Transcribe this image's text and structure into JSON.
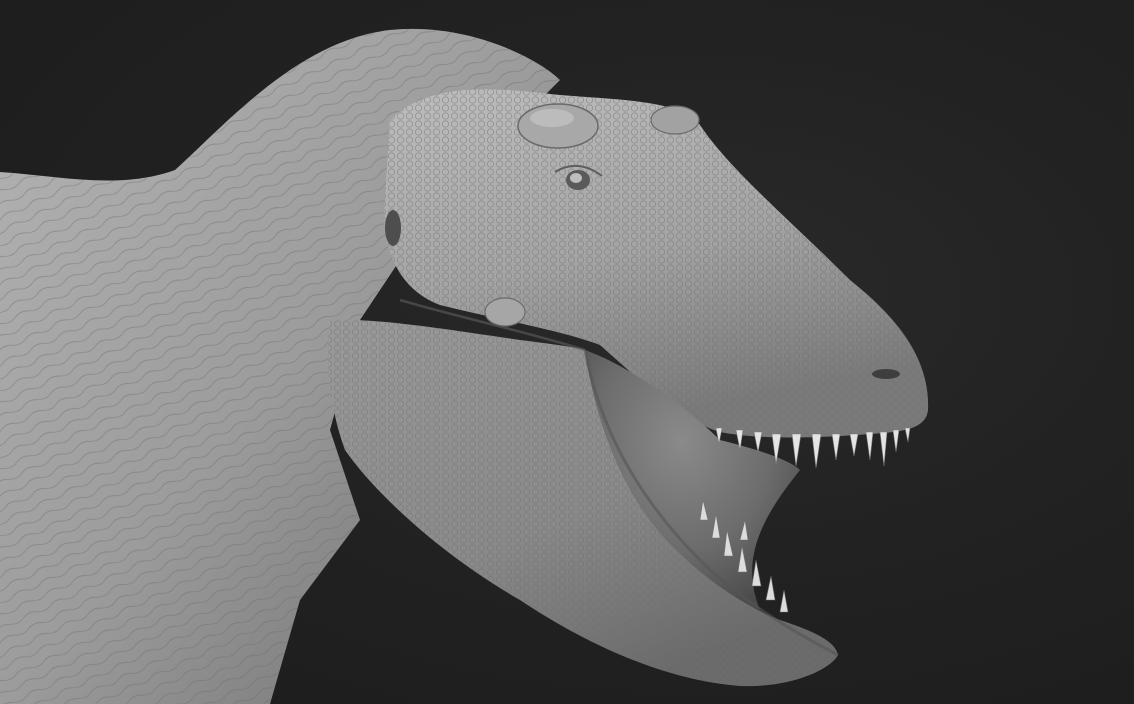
{
  "scene": {
    "subject": "sculpted-tyrannosaurus-head",
    "background_color": "#222222",
    "skin_light": "#b8b8b8",
    "skin_mid": "#8f8f8f",
    "skin_dark": "#5e5e5e",
    "mouth_interior": "#6f6f6f",
    "tooth_color": "#e6e6e6"
  }
}
